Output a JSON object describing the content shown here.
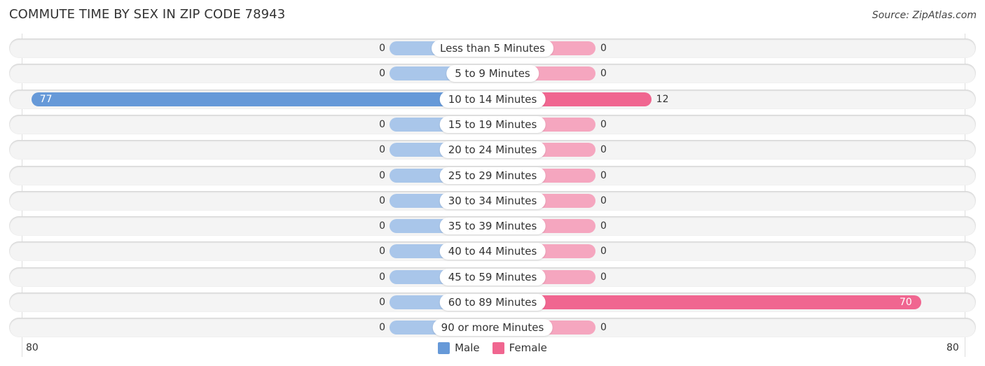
{
  "chart_data": {
    "type": "bar",
    "orientation": "horizontal-diverging",
    "title": "COMMUTE TIME BY SEX IN ZIP CODE 78943",
    "source": "Source: ZipAtlas.com",
    "categories": [
      "Less than 5 Minutes",
      "5 to 9 Minutes",
      "10 to 14 Minutes",
      "15 to 19 Minutes",
      "20 to 24 Minutes",
      "25 to 29 Minutes",
      "30 to 34 Minutes",
      "35 to 39 Minutes",
      "40 to 44 Minutes",
      "45 to 59 Minutes",
      "60 to 89 Minutes",
      "90 or more Minutes"
    ],
    "series": [
      {
        "name": "Male",
        "color": "#6699d8",
        "light_color": "#a9c6ea",
        "values": [
          0,
          0,
          77,
          0,
          0,
          0,
          0,
          0,
          0,
          0,
          0,
          0
        ]
      },
      {
        "name": "Female",
        "color": "#f06690",
        "light_color": "#f5a6bf",
        "values": [
          0,
          0,
          12,
          0,
          0,
          0,
          0,
          0,
          0,
          0,
          70,
          0
        ]
      }
    ],
    "axis": {
      "left_label": "80",
      "right_label": "80",
      "max": 80
    },
    "legend": {
      "position": "bottom-center",
      "items": [
        "Male",
        "Female"
      ]
    }
  }
}
